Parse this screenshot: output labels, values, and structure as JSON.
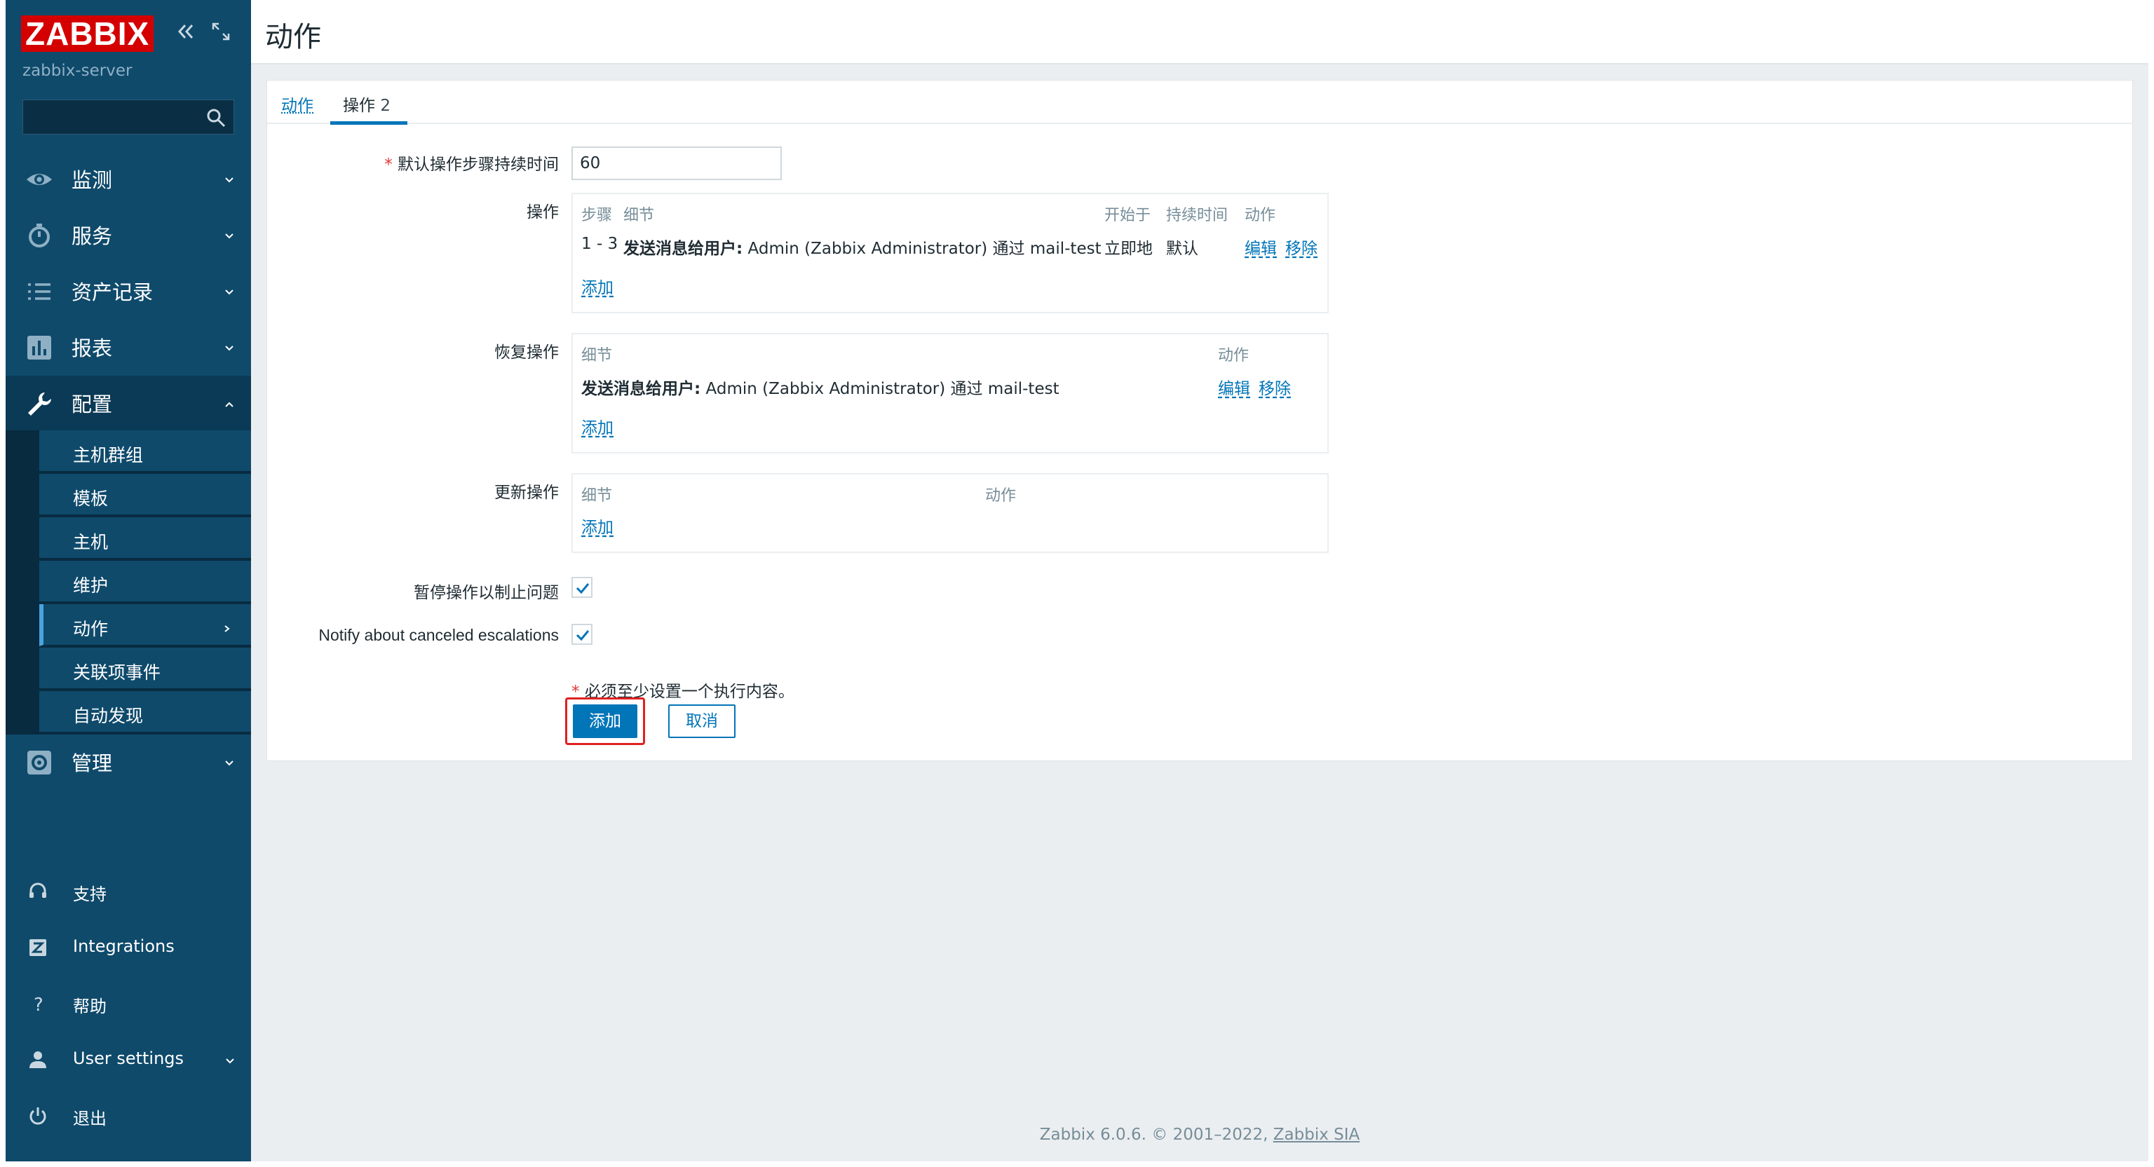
{
  "sidebar": {
    "logo": "ZABBIX",
    "server_name": "zabbix-server",
    "search_placeholder": "",
    "menu": [
      {
        "label": "监测",
        "icon": "eye-icon"
      },
      {
        "label": "服务",
        "icon": "stopwatch-icon"
      },
      {
        "label": "资产记录",
        "icon": "list-icon"
      },
      {
        "label": "报表",
        "icon": "bar-chart-icon"
      },
      {
        "label": "配置",
        "icon": "wrench-icon"
      },
      {
        "label": "管理",
        "icon": "gear-icon"
      }
    ],
    "config_submenu": [
      "主机群组",
      "模板",
      "主机",
      "维护",
      "动作",
      "关联项事件",
      "自动发现"
    ],
    "bottom": [
      {
        "label": "支持",
        "icon": "headset-icon"
      },
      {
        "label": "Integrations",
        "icon": "zabbix-z-icon"
      },
      {
        "label": "帮助",
        "icon": "question-icon"
      },
      {
        "label": "User settings",
        "icon": "user-icon"
      },
      {
        "label": "退出",
        "icon": "power-icon"
      }
    ]
  },
  "header": {
    "title": "动作"
  },
  "tabs": {
    "action": "动作",
    "operations": "操作",
    "operations_count": "2"
  },
  "form": {
    "step_duration_label": "默认操作步骤持续时间",
    "step_duration_value": "60",
    "operations_label": "操作",
    "operations": {
      "headers": {
        "steps": "步骤",
        "details": "细节",
        "start_in": "开始于",
        "duration": "持续时间",
        "action": "动作"
      },
      "row": {
        "steps": "1 - 3",
        "details_bold": "发送消息给用户:",
        "details_text": " Admin (Zabbix Administrator) 通过 mail-test",
        "start_in": "立即地",
        "duration": "默认",
        "edit": "编辑",
        "remove": "移除"
      },
      "add": "添加"
    },
    "recovery_label": "恢复操作",
    "recovery": {
      "headers": {
        "details": "细节",
        "action": "动作"
      },
      "row": {
        "details_bold": "发送消息给用户:",
        "details_text": " Admin (Zabbix Administrator) 通过 mail-test",
        "edit": "编辑",
        "remove": "移除"
      },
      "add": "添加"
    },
    "update_label": "更新操作",
    "update": {
      "headers": {
        "details": "细节",
        "action": "动作"
      },
      "add": "添加"
    },
    "pause_label": "暂停操作以制止问题",
    "pause_checked": true,
    "notify_label": "Notify about canceled escalations",
    "notify_checked": true,
    "hint": "必须至少设置一个执行内容。",
    "add_button": "添加",
    "cancel_button": "取消"
  },
  "footer": {
    "text": "Zabbix 6.0.6. © 2001–2022, ",
    "link": "Zabbix SIA"
  },
  "colors": {
    "sidebar": "#0f4a6b",
    "accent": "#0275b8",
    "logo": "#d40000",
    "required": "#e33734"
  }
}
